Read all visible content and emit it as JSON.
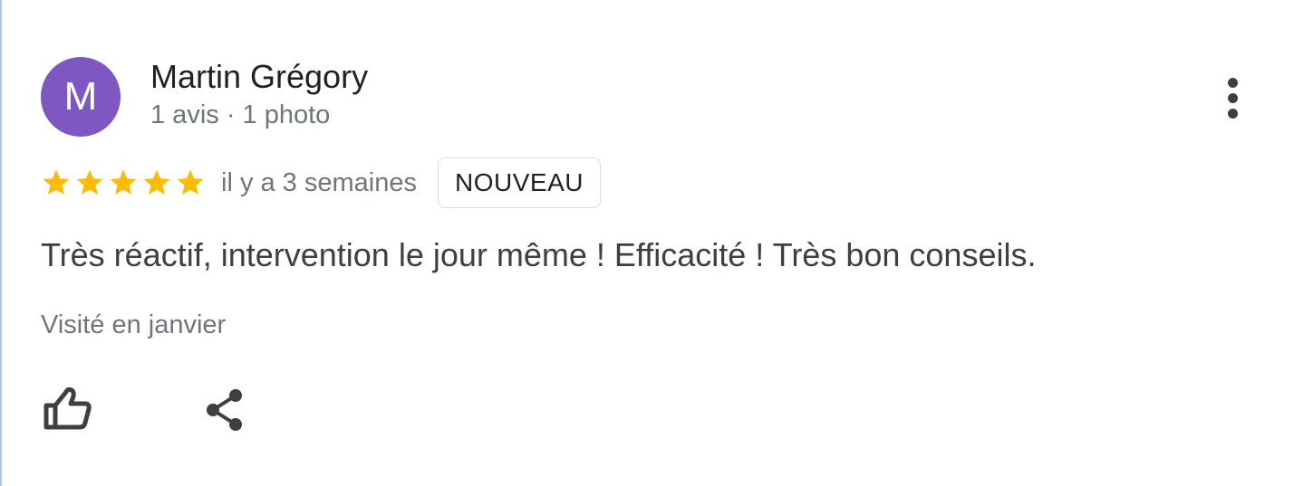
{
  "review": {
    "author": {
      "initial": "M",
      "name": "Martin Grégory",
      "meta": "1 avis · 1 photo",
      "avatar_color": "#7e57c2"
    },
    "rating": {
      "stars": 5,
      "max": 5,
      "star_color": "#fbbc04"
    },
    "date": "il y a 3 semaines",
    "badge": "NOUVEAU",
    "text": "Très réactif, intervention le jour même ! Efficacité ! Très bon conseils.",
    "visited": "Visité en janvier"
  },
  "actions": {
    "more_icon": "more-vert-icon",
    "like_icon": "thumb-up-outline-icon",
    "share_icon": "share-icon"
  }
}
